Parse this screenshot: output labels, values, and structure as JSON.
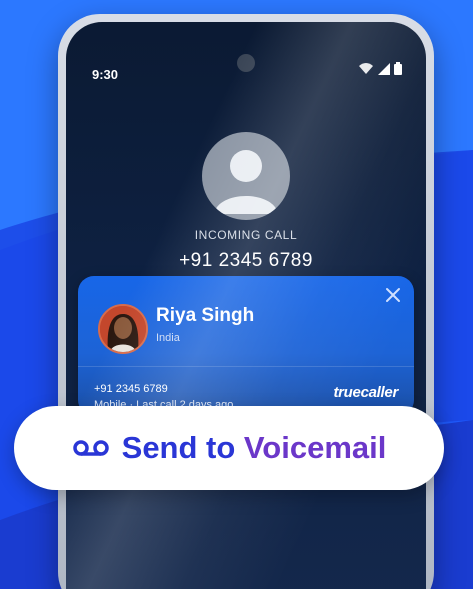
{
  "colors": {
    "background": "#1f5bff",
    "card": "#1766e8",
    "voicemail_text": "#2a36d6",
    "voicemail_accent": "#6b37c9"
  },
  "status_bar": {
    "time": "9:30",
    "icons": [
      "wifi-icon",
      "signal-icon",
      "battery-icon"
    ]
  },
  "incoming": {
    "label": "INCOMING CALL",
    "number": "+91 2345 6789",
    "avatar_icon": "person-placeholder-icon"
  },
  "caller_card": {
    "name": "Riya Singh",
    "country": "India",
    "number": "+91 2345 6789",
    "meta": "Mobile · Last call 2 days ago",
    "brand": "truecaller",
    "close_icon": "close-icon"
  },
  "cta": {
    "label_prefix": "Send to ",
    "label_accent": "Voicemail",
    "icon": "voicemail-icon"
  }
}
